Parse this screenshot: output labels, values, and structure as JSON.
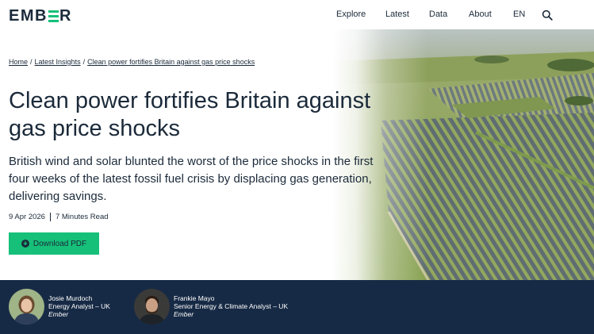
{
  "header": {
    "logo_text": "EMBER",
    "nav": [
      "Explore",
      "Latest",
      "Data",
      "About",
      "EN"
    ],
    "accent": "#16c079"
  },
  "breadcrumb": {
    "home": "Home",
    "section": "Latest Insights",
    "current": "Clean power fortifies Britain against gas price shocks"
  },
  "article": {
    "title": "Clean power fortifies Britain against gas price shocks",
    "subtitle": "British wind and solar blunted the worst of the price shocks in the first four weeks of the latest fossil fuel crisis by displacing gas generation, delivering savings.",
    "date": "9 Apr 2026",
    "read_time": "7 Minutes Read",
    "download_label": "Download PDF"
  },
  "authors": [
    {
      "name": "Josie Murdoch",
      "role": "Energy Analyst – UK",
      "org": "Ember"
    },
    {
      "name": "Frankie Mayo",
      "role": "Senior Energy & Climate Analyst – UK",
      "org": "Ember"
    }
  ],
  "colors": {
    "navy": "#172a45",
    "text": "#1b2a3a",
    "green": "#16c079"
  }
}
